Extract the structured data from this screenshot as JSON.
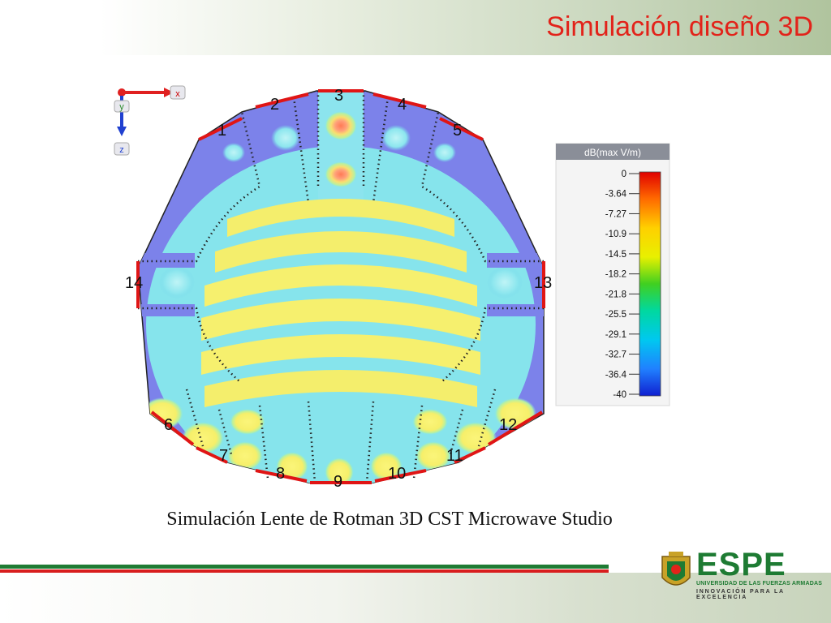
{
  "header": {
    "title": "Simulación diseño 3D"
  },
  "figure": {
    "axes": {
      "x": "x",
      "y": "y",
      "z": "z"
    },
    "ports": [
      "1",
      "2",
      "3",
      "4",
      "5",
      "6",
      "7",
      "8",
      "9",
      "10",
      "11",
      "12",
      "13",
      "14"
    ],
    "colorbar": {
      "title": "dB(max V/m)",
      "ticks": [
        "0",
        "-3.64",
        "-7.27",
        "-10.9",
        "-14.5",
        "-18.2",
        "-21.8",
        "-25.5",
        "-29.1",
        "-32.7",
        "-36.4",
        "-40"
      ]
    }
  },
  "caption": "Simulación Lente de Rotman 3D CST Microwave Studio",
  "logo": {
    "name": "ESPE",
    "line1": "UNIVERSIDAD DE LAS FUERZAS ARMADAS",
    "line2": "INNOVACIÓN PARA LA EXCELENCIA"
  },
  "colors": {
    "title": "#e2231a",
    "brand_green": "#1e7b33",
    "accent_red": "#d81e1e"
  }
}
